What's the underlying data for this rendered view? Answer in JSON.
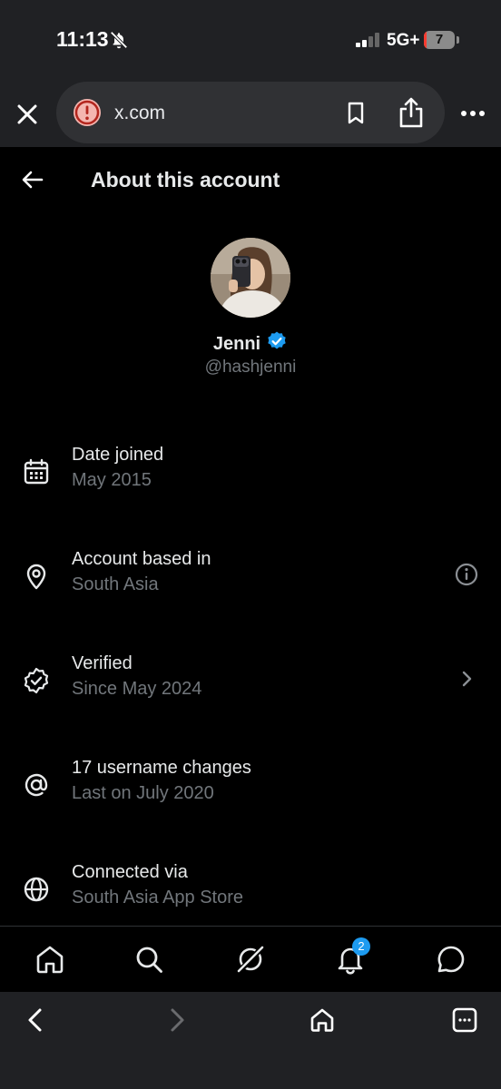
{
  "status_bar": {
    "time": "11:13",
    "network": "5G+",
    "battery": "7",
    "battery_level": 0.07
  },
  "browser": {
    "url": "x.com"
  },
  "header": {
    "title": "About this account"
  },
  "profile": {
    "name": "Jenni",
    "handle": "@hashjenni"
  },
  "rows": [
    {
      "title": "Date joined",
      "subtitle": "May 2015",
      "icon": "calendar-icon"
    },
    {
      "title": "Account based in",
      "subtitle": "South Asia",
      "icon": "location-pin-icon",
      "action_icon": "info-icon"
    },
    {
      "title": "Verified",
      "subtitle": "Since May 2024",
      "icon": "verified-badge-icon",
      "action_icon": "chevron-right-icon"
    },
    {
      "title": "17 username changes",
      "subtitle": "Last on July 2020",
      "icon": "at-sign-icon"
    },
    {
      "title": "Connected via",
      "subtitle": "South Asia App Store",
      "icon": "globe-icon"
    }
  ],
  "tab_bar": {
    "notification_count": "2"
  },
  "colors": {
    "accent": "#1d9bf0",
    "background": "#000000",
    "muted_text": "#71767b",
    "chrome": "#202124"
  }
}
